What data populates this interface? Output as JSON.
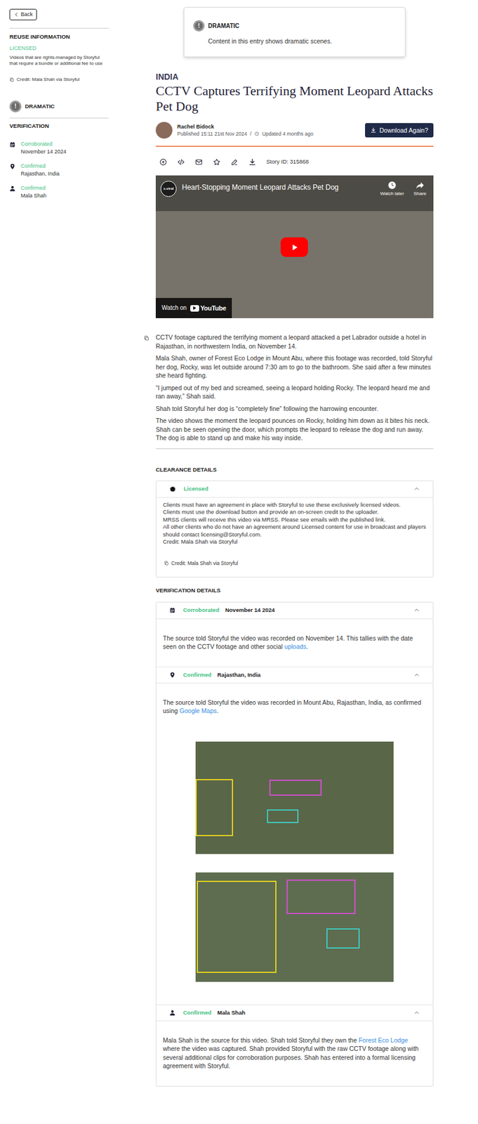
{
  "sidebar": {
    "back": "Back",
    "reuse_heading": "REUSE INFORMATION",
    "license": "LICENSED",
    "license_note": "Videos that are rights-managed by Storyful that require a bundle or additional fee to use",
    "credit": "Credit: Mala Shah via Storyful",
    "badge": {
      "icon": "!",
      "label": "DRAMATIC"
    },
    "verification_heading": "VERIFICATION",
    "verification": [
      {
        "kind": "date",
        "status": "Corroborated",
        "value": "November 14 2024"
      },
      {
        "kind": "location",
        "status": "Confirmed",
        "value": "Rajasthan, India"
      },
      {
        "kind": "source",
        "status": "Confirmed",
        "value": "Mala Shah"
      }
    ]
  },
  "banner": {
    "icon": "!",
    "title": "DRAMATIC",
    "text": "Content in this entry shows dramatic scenes."
  },
  "story": {
    "region": "INDIA",
    "title": "CCTV Captures Terrifying Moment Leopard Attacks Pet Dog",
    "author": "Rachel Bidock",
    "published": "Published 15:11 21st Nov 2024",
    "separator": "/",
    "updated": "Updated 4 months ago",
    "download": "Download Again?",
    "story_id": "Story ID: 315868"
  },
  "video": {
    "channel": "s.viral",
    "title": "Heart-Stopping Moment Leopard Attacks Pet Dog",
    "watch_later": "Watch later",
    "share": "Share",
    "watch_on": "Watch on",
    "platform": "YouTube"
  },
  "paragraphs": [
    "CCTV footage captured the terrifying moment a leopard attacked a pet Labrador outside a hotel in Rajasthan, in northwestern India, on November 14.",
    "Mala Shah, owner of Forest Eco Lodge in Mount Abu, where this footage was recorded, told Storyful her dog, Rocky, was let outside around 7:30 am to go to the bathroom. She said after a few minutes she heard fighting.",
    "“I jumped out of my bed and screamed, seeing a leopard holding Rocky. The leopard heard me and ran away,” Shah said.",
    "Shah told Storyful her dog is “completely fine” following the harrowing encounter.",
    "The video shows the moment the leopard pounces on Rocky, holding him down as it bites his neck. Shah can be seen opening the door, which prompts the leopard to release the dog and run away. The dog is able to stand up and make his way inside."
  ],
  "clearance": {
    "heading": "CLEARANCE DETAILS",
    "status": "Licensed",
    "expanded": true,
    "lines": [
      "Clients must have an agreement in place with Storyful to use these exclusively licensed videos.",
      "Clients must use the download button and provide an on-screen credit to the uploader.",
      "MRSS clients will receive this video via MRSS. Please see emails with the published link.",
      "All other clients who do not have an agreement around Licensed content for use in broadcast and players should contact licensing@Storyful.com.",
      "Credit: Mala Shah via Storyful"
    ],
    "credit": "Credit: Mala Shah via Storyful"
  },
  "verification": {
    "heading": "VERIFICATION DETAILS",
    "items": [
      {
        "kind": "date",
        "status": "Corroborated",
        "value": "November 14 2024",
        "expanded": true,
        "photos": false,
        "body": [
          {
            "text": "The source told Storyful the video was recorded on November 14. This tallies with the date seen on the CCTV footage and other social ",
            "link": false
          },
          {
            "text": "uploads",
            "link": true
          },
          {
            "text": ".",
            "link": false
          }
        ]
      },
      {
        "kind": "location",
        "status": "Confirmed",
        "value": "Rajasthan, India",
        "expanded": true,
        "photos": true,
        "body": [
          {
            "text": "The source told Storyful the video was recorded in Mount Abu, Rajasthan, India, as confirmed using ",
            "link": false
          },
          {
            "text": "Google Maps",
            "link": true
          },
          {
            "text": ".",
            "link": false
          }
        ]
      },
      {
        "kind": "source",
        "status": "Confirmed",
        "value": "Mala Shah",
        "expanded": true,
        "photos": false,
        "body": [
          {
            "text": "Mala Shah is the source for this video. Shah told Storyful they own the ",
            "link": false
          },
          {
            "text": "Forest Eco Lodge",
            "link": true
          },
          {
            "text": " where the video was captured. Shah provided Storyful with the raw CCTV footage along with several additional clips for corroboration purposes. Shah has entered into a formal licensing agreement with Storyful.",
            "link": false
          }
        ]
      }
    ]
  }
}
